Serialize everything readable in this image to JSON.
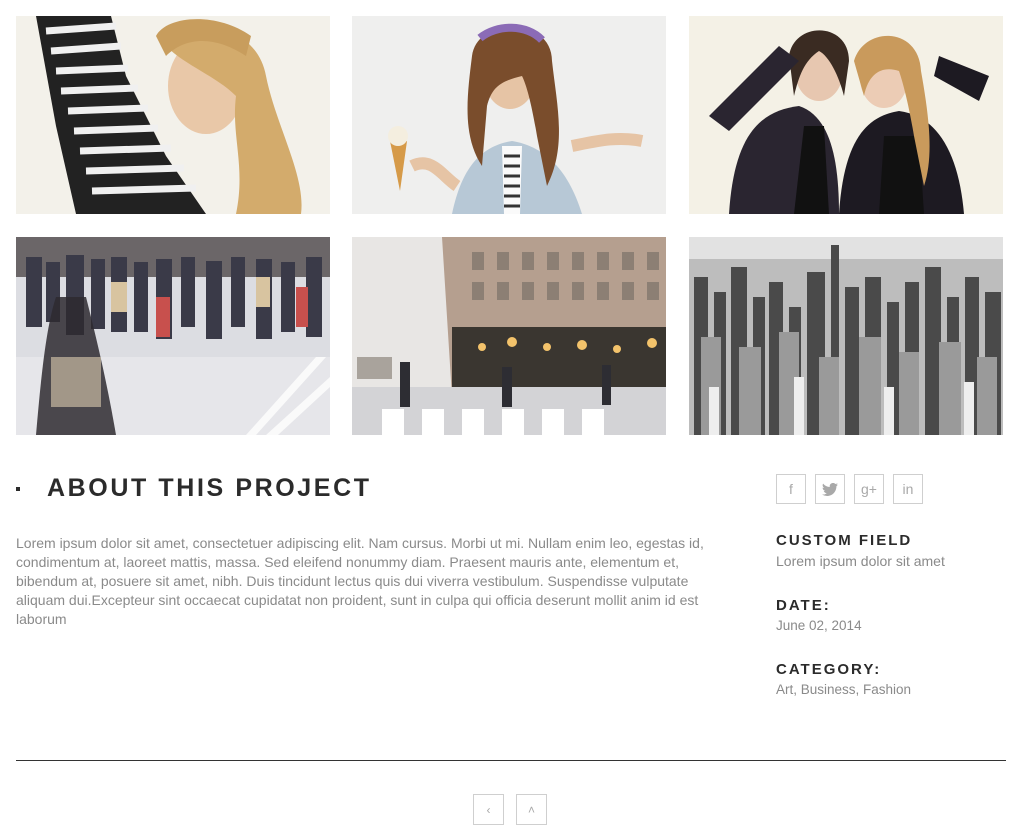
{
  "gallery": {
    "images": [
      {
        "name": "portrait-striped-shirt"
      },
      {
        "name": "girl-with-ice-cream"
      },
      {
        "name": "two-girls-posing"
      },
      {
        "name": "crowd-crossing-street"
      },
      {
        "name": "blurred-city-street"
      },
      {
        "name": "city-aerial-bw"
      }
    ]
  },
  "about": {
    "title": "ABOUT THIS PROJECT",
    "text": "Lorem ipsum dolor sit amet, consectetuer adipiscing elit. Nam cursus. Morbi ut mi. Nullam enim leo, egestas id, condimentum at, laoreet mattis, massa. Sed eleifend nonummy diam. Praesent mauris ante, elementum et, bibendum at, posuere sit amet, nibh. Duis tincidunt lectus quis dui viverra vestibulum. Suspendisse vulputate aliquam dui.Excepteur sint occaecat cupidatat non proident, sunt in culpa qui officia deserunt mollit anim id est laborum"
  },
  "social": {
    "facebook": "f",
    "twitter": "t",
    "googleplus": "g+",
    "linkedin": "in"
  },
  "meta": {
    "custom_label": "CUSTOM FIELD",
    "custom_value": "Lorem ipsum dolor sit amet",
    "date_label": "DATE:",
    "date_value": "June 02, 2014",
    "category_label": "CATEGORY:",
    "category_value": "Art, Business, Fashion"
  },
  "pager": {
    "prev": "‹",
    "up": "˄"
  },
  "colors": {
    "heading": "#2b2b2b",
    "body_text": "#8a8a8a",
    "border": "#cfcfcf",
    "divider": "#333333"
  }
}
